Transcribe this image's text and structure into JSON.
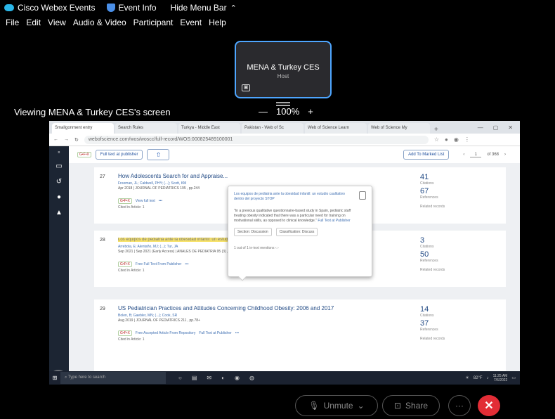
{
  "title_bar": {
    "app_name": "Cisco Webex Events",
    "event_info": "Event Info",
    "hide_menu_bar": "Hide Menu Bar",
    "caret": "^"
  },
  "menu": [
    "File",
    "Edit",
    "View",
    "Audio & Video",
    "Participant",
    "Event",
    "Help"
  ],
  "presenter": {
    "name": "MENA & Turkey CES",
    "role": "Host"
  },
  "viewing_label": "Viewing MENA & Turkey CES's screen",
  "zoom": {
    "minus": "—",
    "level": "100%",
    "plus": "+"
  },
  "shared_screen": {
    "browser_tabs": [
      "Smallgonment entry",
      "Search Rules",
      "Turkya - Middle East",
      "Pakistan - Web of Sc",
      "Web of Science Learn",
      "Web of Science My"
    ],
    "url": "webofscience.com/wos/woscc/full-record/WOS:000825489100001",
    "toolbar": {
      "fulltext_btn": "Full text at publisher",
      "marked_list_btn": "Add To Marked List",
      "page_current": "1",
      "page_total": "of 368"
    },
    "records": [
      {
        "num": "27",
        "title": "How Adolescents Search for and Appraise...",
        "authors": "Freeman, JL; Caldwell, PHY; (...); Scott, KM",
        "journal": "Apr 2018 | JOURNAL OF PEDIATRICS 195 , pp.244",
        "link": "View full text",
        "cited": "Cited in Article: 1",
        "citations": "41",
        "references": "67"
      },
      {
        "num": "28",
        "title": "Los equipos de pediatria ante la obesidad infantil: un estudio cualitativo dentro del proyecto STOP",
        "authors": "Arrebola, E; Alentaño, MJ; (...); Tur, JA",
        "journal": "Sep 2021 | Sep 2021 (Early Access) | ANALES DE PEDIATRIA 95 (3) , pp.174-185",
        "link": "Free Full Text From Publisher",
        "cited": "Cited in Article: 1",
        "citations": "3",
        "references": "50"
      },
      {
        "num": "29",
        "title": "US Pediatrician Practices and Attitudes Concerning Childhood Obesity: 2006 and 2017",
        "authors": "Bolen, B; Gaebler, MN; (...); Cook, SR",
        "journal": "Aug 2019 | JOURNAL OF PEDIATRICS 211 , pp.78+",
        "link": "Free Accepted Article From Repository",
        "link2": "Full Text at Publisher",
        "cited": "Cited in Article: 1",
        "citations": "14",
        "references": "37"
      }
    ],
    "metric_labels": {
      "citations": "Citations",
      "references": "References",
      "related": "Related records"
    },
    "chip_label": "G•F•X",
    "popover": {
      "title": "Los equipos de pediatria ante la obesidad infantil: un estudio cualitativo dentro del proyecto STOP",
      "body": "\"In a previous qualitative questionnaire-based study in Spain, pediatric staff treating obesity indicated that there was a particular need for training on motivational skills, as opposed to clinical knowledge.\"",
      "body_link": "Full Text at Publisher",
      "tag1": "Section: Discussion",
      "tag2": "Classification: Discuss",
      "footer": "1 out of 1 in-text mentions"
    },
    "taskbar": {
      "search_placeholder": "Type here to search",
      "weather": "82°F",
      "time": "11:25 AM",
      "date": "7/6/2022"
    },
    "avatar_initials": "EN",
    "help_badge": "2",
    "help_label": "?"
  },
  "controls": {
    "unmute": "Unmute",
    "share": "Share",
    "more": "···",
    "end": "✕"
  }
}
